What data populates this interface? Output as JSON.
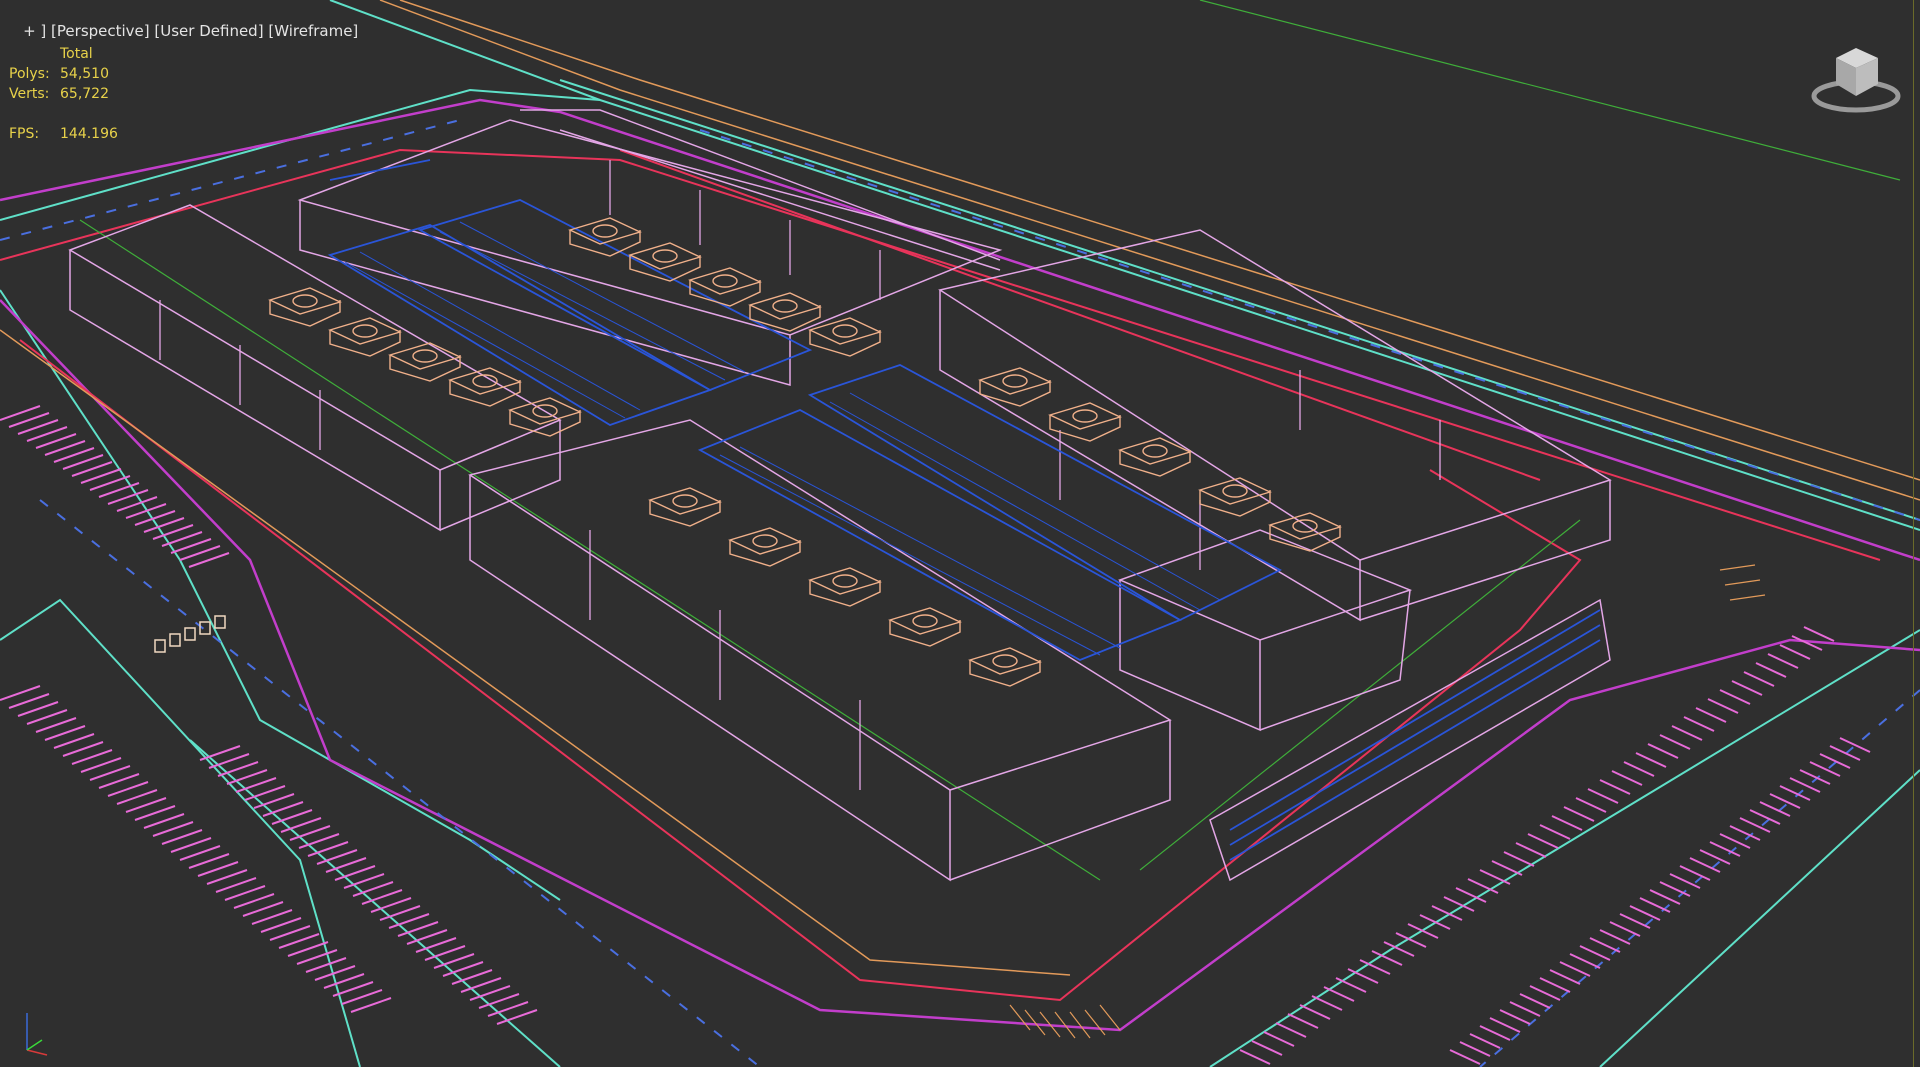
{
  "viewport": {
    "label_parts": [
      "+",
      "Perspective",
      "User Defined",
      "Wireframe"
    ],
    "stats": {
      "header": "Total",
      "polys_label": "Polys:",
      "polys_value": "54,510",
      "verts_label": "Verts:",
      "verts_value": "65,722",
      "fps_label": "FPS:",
      "fps_value": "144.196"
    },
    "icons": {
      "viewcube": "viewcube-icon",
      "axis_tripod": "axis-tripod-icon"
    }
  },
  "colors": {
    "background": "#2f2f2f",
    "stats_text": "#e8d24a",
    "label_text": "#e4e4e4",
    "curb_cyan": "#5fe0c8",
    "parking_magenta": "#e86bd8",
    "building_pink": "#e3a6e6",
    "roof_blue": "#2a55d8",
    "hvac_peach": "#f0b08a",
    "road_red": "#e8345a",
    "ground_green": "#3fae3a"
  }
}
